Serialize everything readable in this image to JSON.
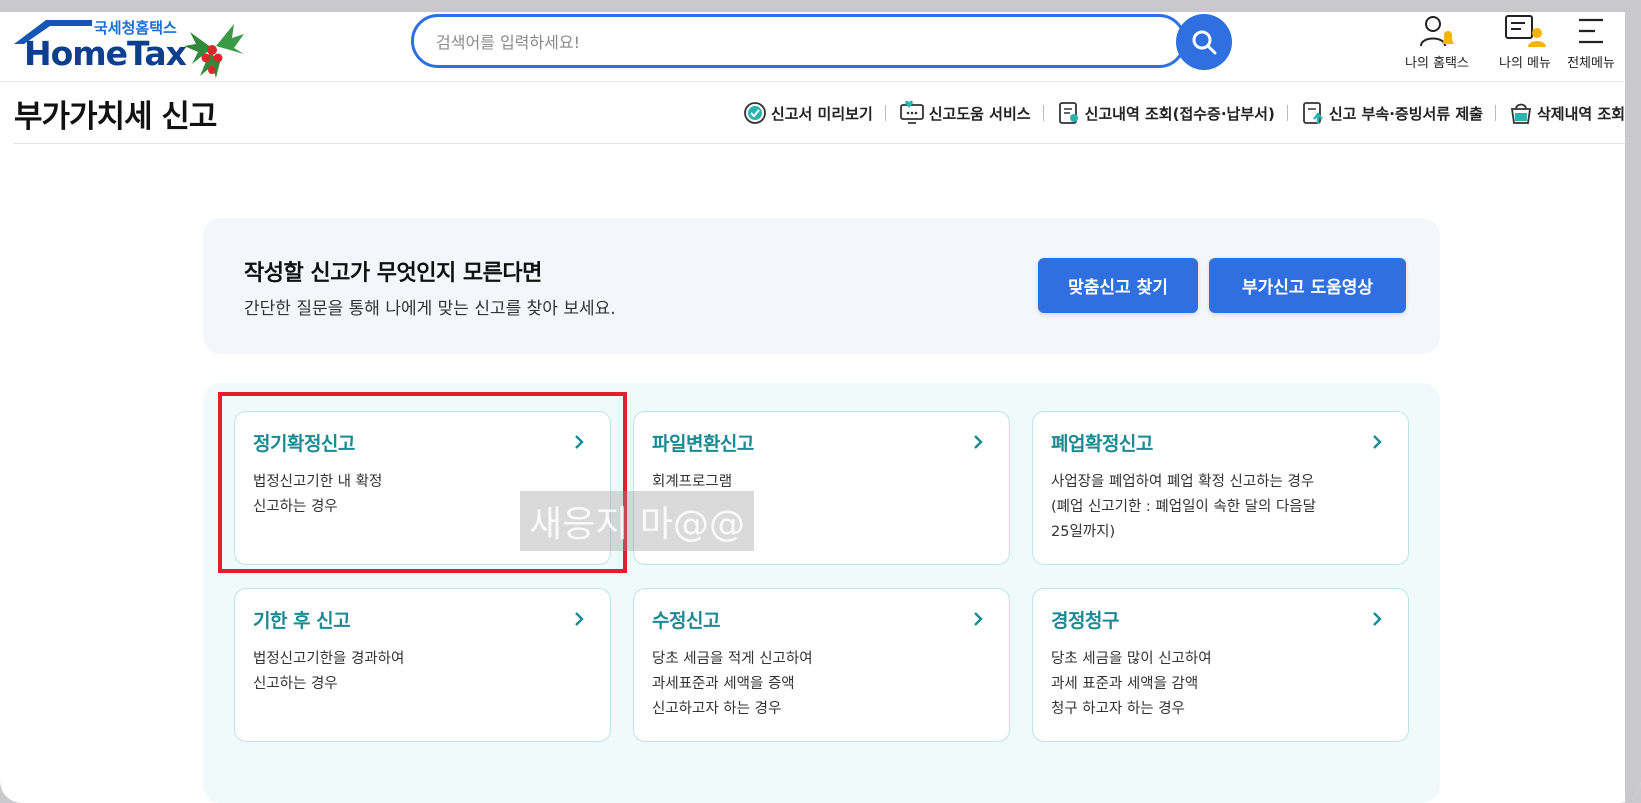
{
  "header": {
    "logo_sub": "국세청홈택스",
    "logo_main": "HomeTax",
    "search_placeholder": "검색어를 입력하세요!",
    "icons": [
      {
        "label": "나의 홈택스",
        "icon": "user-bell-icon"
      },
      {
        "label": "나의 메뉴",
        "icon": "user-list-icon"
      },
      {
        "label": "전체메뉴",
        "icon": "menu-icon"
      }
    ]
  },
  "subheader": {
    "title": "부가가치세 신고",
    "links": [
      {
        "label": "신고서 미리보기",
        "icon": "check-badge-icon"
      },
      {
        "label": "신고도움 서비스",
        "icon": "monitor-heart-icon"
      },
      {
        "label": "신고내역 조회(접수증·납부서)",
        "icon": "document-search-icon"
      },
      {
        "label": "신고 부속·증빙서류 제출",
        "icon": "document-upload-icon"
      },
      {
        "label": "삭제내역 조회",
        "icon": "trash-basket-icon"
      }
    ]
  },
  "banner": {
    "title": "작성할 신고가 무엇인지 모른다면",
    "desc": "간단한 질문을 통해 나에게 맞는 신고를 찾아 보세요.",
    "btn_find": "맞춤신고 찾기",
    "btn_video": "부가신고 도움영상"
  },
  "cards": [
    {
      "title": "정기확정신고",
      "desc": "법정신고기한 내 확정\n신고하는 경우"
    },
    {
      "title": "파일변환신고",
      "desc": "회계프로그램"
    },
    {
      "title": "폐업확정신고",
      "desc": "사업장을 폐업하여 폐업 확정 신고하는 경우\n(폐업 신고기한 : 폐업일이 속한 달의 다음달\n25일까지)"
    },
    {
      "title": "기한 후 신고",
      "desc": "법정신고기한을 경과하여\n신고하는 경우"
    },
    {
      "title": "수정신고",
      "desc": "당초 세금을 적게 신고하여\n과세표준과 세액을 증액\n신고하고자 하는 경우"
    },
    {
      "title": "경정청구",
      "desc": "당초 세금을 많이 신고하여\n과세 표준과 세액을 감액\n청구 하고자 하는 경우"
    }
  ],
  "watermark": "새응지 마@@",
  "colors": {
    "accent": "#2f6fdf",
    "card_title": "#1b8a94",
    "highlight": "#e0202a"
  }
}
